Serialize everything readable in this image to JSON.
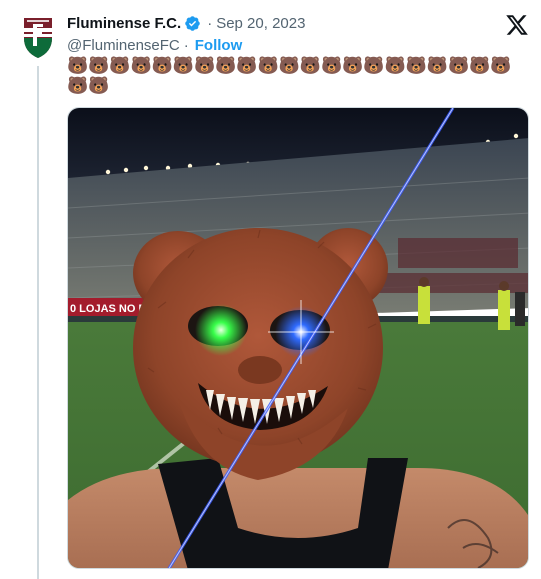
{
  "tweet": {
    "author_name": "Fluminense F.C.",
    "verified": true,
    "separator": "·",
    "date": "Sep 20, 2023",
    "handle": "@FluminenseFC",
    "handle_separator": "·",
    "follow_label": "Follow",
    "text": "🐻🐻🐻🐻🐻🐻🐻🐻🐻🐻🐻🐻🐻🐻🐻🐻🐻🐻🐻🐻🐻🐻🐻",
    "avatar_icon": "fluminense-crest-icon",
    "platform_icon": "x-logo-icon",
    "media": {
      "banner_text": "0 LOJAS NO BRASI",
      "icon": "bear-mask-photo"
    }
  },
  "colors": {
    "accent": "#1d9bf0",
    "secondary_text": "#536471",
    "club_maroon": "#7a1f2b",
    "club_green": "#0d6b3a"
  }
}
